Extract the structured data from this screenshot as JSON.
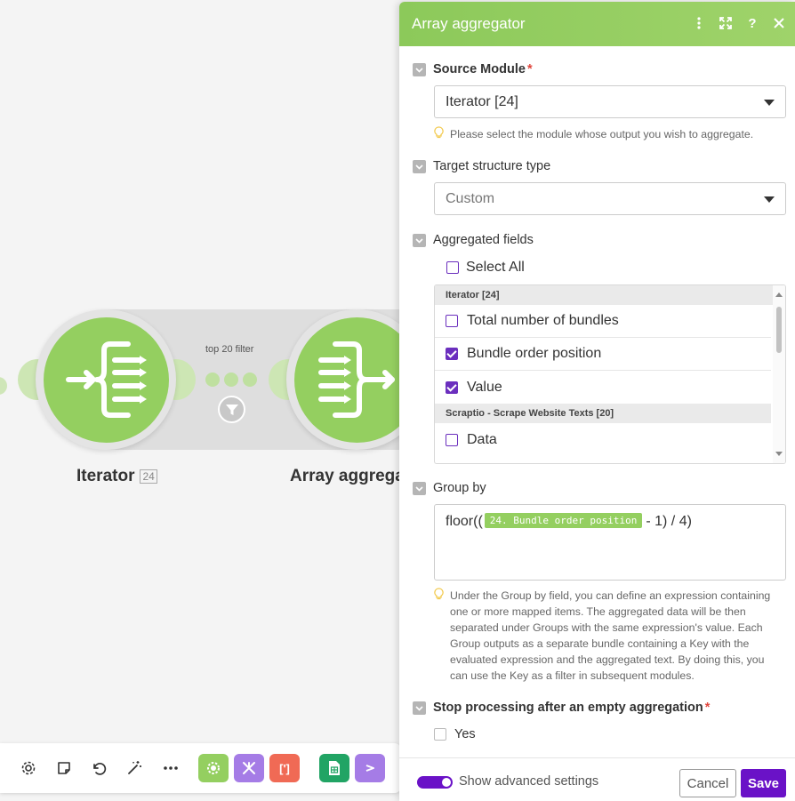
{
  "canvas": {
    "nodes": [
      {
        "label": "Iterator",
        "count": "24"
      },
      {
        "label": "Array aggrega",
        "count": ""
      }
    ],
    "filter_label": "top 20 filter",
    "toolbar": {
      "icons": [
        "settings-icon",
        "notes-icon",
        "undo-icon",
        "magic-wand-icon",
        "more-icon"
      ],
      "apps": [
        {
          "name": "tools-app",
          "color": "#94cf60"
        },
        {
          "name": "flow-control-app",
          "color": "#a57ce6"
        },
        {
          "name": "json-app",
          "color": "#f06a55",
          "label": "[']"
        },
        {
          "name": "google-sheets-app",
          "color": "#21a464"
        },
        {
          "name": "make-app",
          "color": "#a57ce6"
        }
      ]
    }
  },
  "panel": {
    "title": "Array aggregator",
    "source_module": {
      "label": "Source Module",
      "value": "Iterator [24]",
      "hint": "Please select the module whose output you wish to aggregate."
    },
    "target_structure": {
      "label": "Target structure type",
      "value": "Custom"
    },
    "aggregated_fields": {
      "label": "Aggregated fields",
      "select_all": "Select All",
      "groups": [
        {
          "name": "Iterator [24]",
          "items": [
            {
              "label": "Total number of bundles",
              "checked": false
            },
            {
              "label": "Bundle order position",
              "checked": true
            },
            {
              "label": "Value",
              "checked": true
            }
          ]
        },
        {
          "name": "Scraptio - Scrape Website Texts [20]",
          "items": [
            {
              "label": "Data",
              "checked": false
            }
          ]
        }
      ]
    },
    "group_by": {
      "label": "Group by",
      "expr_before": "floor((",
      "pill": "24. Bundle order position",
      "expr_after": "- 1) / 4)",
      "hint": "Under the Group by field, you can define an expression containing one or more mapped items. The aggregated data will be then separated under Groups with the same expression's value. Each Group outputs as a separate bundle containing a Key with the evaluated expression and the aggregated text. By doing this, you can use the Key as a filter in subsequent modules."
    },
    "stop_processing": {
      "label": "Stop processing after an empty aggregation",
      "option": "Yes"
    },
    "footer": {
      "advanced_label": "Show advanced settings",
      "cancel": "Cancel",
      "save": "Save"
    }
  }
}
